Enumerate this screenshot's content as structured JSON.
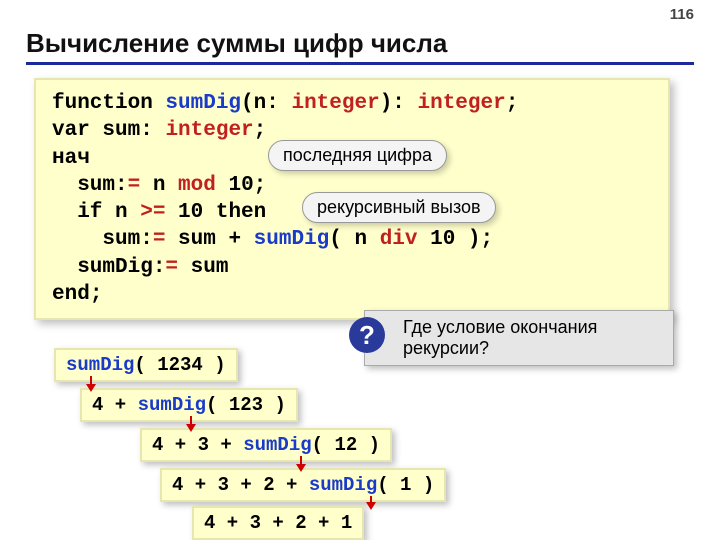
{
  "page_number": "116",
  "title": "Вычисление суммы цифр числа",
  "code": {
    "l1_kw1": "function ",
    "l1_fn": "sumDig",
    "l1_p1": "(n: ",
    "l1_tp1": "integer",
    "l1_p2": "): ",
    "l1_tp2": "integer",
    "l1_end": ";",
    "l2_kw": "var",
    "l2_txt": " sum: ",
    "l2_tp": "integer",
    "l2_end": ";",
    "l3": "нач",
    "l4_a": "  sum:",
    "l4_op": "=",
    "l4_b": " n ",
    "l4_mod": "mod",
    "l4_c": " 10",
    "l4_end": ";",
    "l5_a": "  if n",
    "l5_ge": " >= ",
    "l5_b": "10 then",
    "l6_a": "    sum:",
    "l6_op": "=",
    "l6_b": " sum + ",
    "l6_fn": "sumDig",
    "l6_p1": "( n ",
    "l6_div": "div",
    "l6_c": " 10 )",
    "l6_end": ";",
    "l7_a": "  sumDig:",
    "l7_op": "=",
    "l7_b": " sum",
    "l8": "end",
    "l8_end": ";"
  },
  "bubbles": {
    "last_digit": "последняя цифра",
    "recursive_call": "рекурсивный вызов"
  },
  "question": {
    "icon": "?",
    "text": "Где условие окончания рекурсии?"
  },
  "steps": {
    "s1_fn": "sumDig",
    "s1_p": "( 1234 )",
    "s2_a": "4 + ",
    "s2_fn": "sumDig",
    "s2_p": "( 123 )",
    "s3_a": "4 + 3 + ",
    "s3_fn": "sumDig",
    "s3_p": "( 12 )",
    "s4_a": "4 + 3 + 2 + ",
    "s4_fn": "sumDig",
    "s4_p": "( 1 )",
    "s5": "4 + 3 + 2 + 1"
  }
}
